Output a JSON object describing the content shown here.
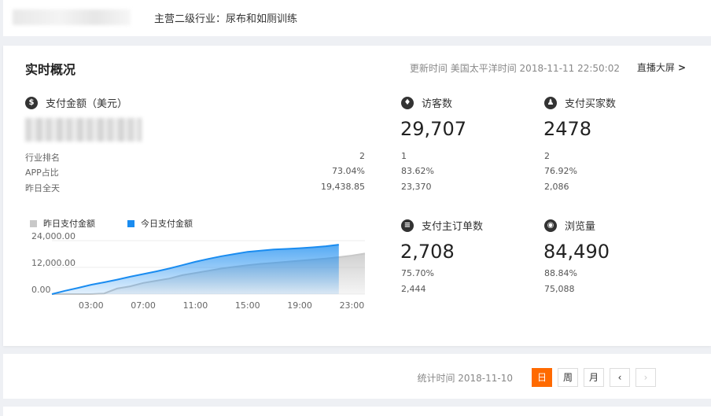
{
  "header": {
    "industry_label": "主营二级行业：尿布和如厕训练"
  },
  "overview": {
    "title": "实时概况",
    "update_time": "更新时间 美国太平洋时间 2018-11-11 22:50:02",
    "live_link": "直播大屏",
    "payment": {
      "icon": "dollar-icon",
      "label": "支付金额（美元）",
      "rows": [
        {
          "label": "行业排名",
          "value": "2"
        },
        {
          "label": "APP占比",
          "value": "73.04%"
        },
        {
          "label": "昨日全天",
          "value": "19,438.85"
        }
      ]
    },
    "visitors": {
      "icon": "visitor-icon",
      "label": "访客数",
      "value": "29,707",
      "rank": "1",
      "app_ratio": "83.62%",
      "yesterday": "23,370"
    },
    "buyers": {
      "icon": "buyer-icon",
      "label": "支付买家数",
      "value": "2478",
      "rank": "2",
      "app_ratio": "76.92%",
      "yesterday": "2,086"
    },
    "orders": {
      "icon": "order-icon",
      "label": "支付主订单数",
      "value": "2,708",
      "app_ratio": "75.70%",
      "yesterday": "2,444"
    },
    "pageviews": {
      "icon": "eye-icon",
      "label": "浏览量",
      "value": "84,490",
      "app_ratio": "88.84%",
      "yesterday": "75,088"
    }
  },
  "colors": {
    "today": "#1a8cf0",
    "yesterday": "#c8c8c8",
    "accent": "#ff6a00"
  },
  "chart_data": {
    "type": "area",
    "legend": [
      "昨日支付金额",
      "今日支付金额"
    ],
    "y_ticks": [
      "24,000.00",
      "12,000.00",
      "0.00"
    ],
    "ylim": [
      0,
      24000
    ],
    "x_ticks": [
      "03:00",
      "07:00",
      "11:00",
      "15:00",
      "19:00",
      "23:00"
    ],
    "xlim": [
      0,
      24
    ],
    "series": [
      {
        "name": "昨日支付金额",
        "x": [
          0,
          1,
          2,
          3,
          4,
          5,
          6,
          7,
          8,
          9,
          10,
          11,
          12,
          13,
          14,
          15,
          16,
          17,
          18,
          19,
          20,
          21,
          22,
          23,
          24
        ],
        "values": [
          0,
          0,
          0,
          0,
          300,
          2500,
          3500,
          5000,
          6000,
          7000,
          8500,
          9500,
          10500,
          11500,
          12300,
          13000,
          13600,
          14000,
          14500,
          15000,
          15500,
          16000,
          16600,
          17300,
          18200
        ]
      },
      {
        "name": "今日支付金额",
        "x": [
          0,
          1,
          2,
          3,
          4,
          5,
          6,
          7,
          8,
          9,
          10,
          11,
          12,
          13,
          14,
          15,
          16,
          17,
          18,
          19,
          20,
          21,
          22
        ],
        "values": [
          0,
          1500,
          2800,
          4200,
          5300,
          6500,
          7800,
          9000,
          10200,
          11500,
          13000,
          14500,
          15800,
          17000,
          18000,
          19000,
          19500,
          20000,
          20300,
          20600,
          21000,
          21500,
          22200
        ]
      }
    ]
  },
  "stats_bar": {
    "stat_time": "统计时间 2018-11-10",
    "day": "日",
    "week": "周",
    "month": "月",
    "prev": "‹",
    "next": "›"
  }
}
